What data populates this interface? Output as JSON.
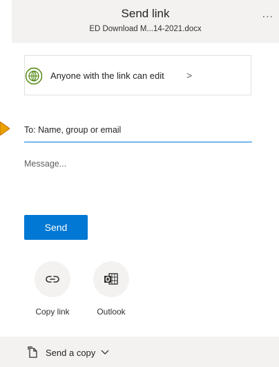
{
  "header": {
    "title": "Send link",
    "subtitle": "ED Download M...14-2021.docx",
    "more_label": "..."
  },
  "permission": {
    "text": "Anyone with the link can edit",
    "chevron": ">"
  },
  "form": {
    "to_placeholder": "To: Name, group or email",
    "message_placeholder": "Message..."
  },
  "send_label": "Send",
  "actions": [
    {
      "label": "Copy link",
      "icon": "link-icon"
    },
    {
      "label": "Outlook",
      "icon": "outlook-icon"
    }
  ],
  "footer": {
    "send_copy_label": "Send a copy",
    "icon": "document-icon"
  },
  "colors": {
    "accent": "#0078d4",
    "globe": "#498205",
    "panel_bg": "#f3f2f1",
    "marker": "#e8a200"
  }
}
